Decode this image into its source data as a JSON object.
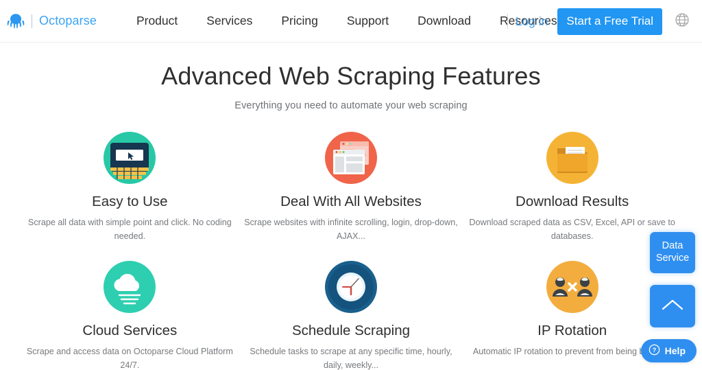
{
  "navbar": {
    "logo_icon": "octopus-icon",
    "brand": "Octoparse",
    "links": [
      {
        "label": "Product"
      },
      {
        "label": "Services"
      },
      {
        "label": "Pricing"
      },
      {
        "label": "Support"
      },
      {
        "label": "Download"
      },
      {
        "label": "Resources"
      }
    ],
    "login_label": "Log in",
    "trial_label": "Start a Free Trial",
    "globe_icon": "globe-icon",
    "accent_color": "#2196f3",
    "link_color": "#4aa3e8"
  },
  "hero": {
    "title": "Advanced Web Scraping Features",
    "subtitle": "Everything you need to automate your web scraping"
  },
  "features": [
    {
      "icon": "laptop-point-click-icon",
      "icon_color": "#28c8a6",
      "title": "Easy to Use",
      "desc": "Scrape all data with simple point and click. No coding needed."
    },
    {
      "icon": "browser-windows-icon",
      "icon_color": "#f06449",
      "title": "Deal With All Websites",
      "desc": "Scrape websites with infinite scrolling, login, drop-down, AJAX..."
    },
    {
      "icon": "folder-documents-icon",
      "icon_color": "#f5b335",
      "title": "Download Results",
      "desc": "Download scraped data as CSV, Excel, API or save to databases."
    },
    {
      "icon": "cloud-icon",
      "icon_color": "#2ecfb0",
      "title": "Cloud Services",
      "desc": "Scrape and access data on Octoparse Cloud Platform 24/7."
    },
    {
      "icon": "clock-icon",
      "icon_color": "#14537d",
      "title": "Schedule Scraping",
      "desc": "Schedule tasks to scrape at any specific time, hourly, daily, weekly..."
    },
    {
      "icon": "ip-rotation-users-icon",
      "icon_color": "#f2ad3e",
      "title": "IP Rotation",
      "desc": "Automatic IP rotation to prevent from being blocked."
    }
  ],
  "floating": {
    "data_service_line1": "Data",
    "data_service_line2": "Service",
    "scroll_top_icon": "chevron-up-icon",
    "help_icon": "question-circle-icon",
    "help_label": "Help",
    "widget_color": "#2f8ff0"
  }
}
